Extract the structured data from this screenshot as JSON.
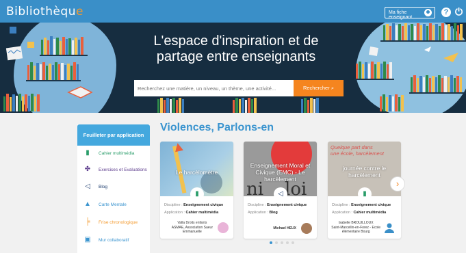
{
  "header": {
    "logo_main": "Bibliothèqu",
    "logo_accent": "e",
    "fiche_label": "Ma fiche enseignant"
  },
  "hero": {
    "title_line1": "L'espace d'inspiration et de",
    "title_line2": "partage entre enseignants",
    "search_placeholder": "Recherchez une matière, un niveau, un thème, une activité...",
    "search_button": "Rechercher"
  },
  "sidebar": {
    "title": "Feuilleter par application",
    "items": [
      {
        "label": "Cahier multimédia",
        "icon": "notebook-icon",
        "color": "#2a9d6a"
      },
      {
        "label": "Exercices et Evaluations",
        "icon": "puzzle-icon",
        "color": "#5b3a8c"
      },
      {
        "label": "Blog",
        "icon": "megaphone-icon",
        "color": "#1a3a6c"
      },
      {
        "label": "Carte Mentale",
        "icon": "mindmap-icon",
        "color": "#3a94cf"
      },
      {
        "label": "Frise chronologique",
        "icon": "timeline-icon",
        "color": "#f39a2e"
      },
      {
        "label": "Mur collaboratif",
        "icon": "wall-icon",
        "color": "#3a94cf"
      }
    ]
  },
  "main": {
    "title": "Violences, Parlons-en",
    "cards": [
      {
        "image_title": "Le harcèlomètre",
        "discipline_label": "Discipline :",
        "discipline": "Enseignement civique",
        "application_label": "Application :",
        "application": "Cahier multimédia",
        "author": "Valla Droits enfants\nASMAE, Association Saeur\nEmmanuelle",
        "badge_icon": "notebook-icon"
      },
      {
        "image_title": "Enseignement Moral et Civique (EMC) - Le harcèlement",
        "discipline_label": "Discipline :",
        "discipline": "Enseignement civique",
        "application_label": "Application :",
        "application": "Blog",
        "author": "Michael HEUX",
        "badge_icon": "megaphone-icon"
      },
      {
        "image_title": "journée contre le harcèlement",
        "image_overlay": "Quelque part dans\nune école, harcèlement",
        "discipline_label": "Discipline :",
        "discipline": "Enseignement civique",
        "application_label": "Application :",
        "application": "Cahier multimédia",
        "author": "Isabelle BROUILLOUX\nSaint-Marcellin-en-Forez - Ecole\nélémentaire Bourg",
        "badge_icon": "notebook-icon"
      }
    ]
  },
  "colors": {
    "topbar": "#3a8fc8",
    "accent_orange": "#f5851f",
    "title_blue": "#3a94cf",
    "hero_dark": "#162d40"
  }
}
